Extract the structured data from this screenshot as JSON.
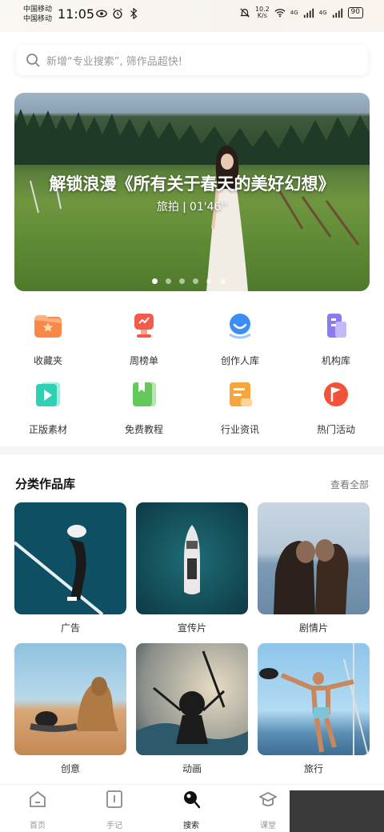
{
  "status_bar": {
    "carrier_1": "中国移动",
    "carrier_2": "中国移动",
    "time": "11:05",
    "net_speed_value": "10.2",
    "net_speed_unit": "K/s",
    "signal_1": "4G",
    "signal_2": "4G",
    "battery": "90"
  },
  "search": {
    "placeholder": "新增“专业搜索”, 筛作品超快!",
    "icon": "search-icon"
  },
  "banner": {
    "title": "解锁浪漫《所有关于春天的美好幻想》",
    "subtitle": "旅拍  ǀ 01'46''",
    "dot_count": 6,
    "active_dot": 1
  },
  "quick_links": [
    {
      "label": "收藏夹",
      "icon": "folder-star-icon",
      "color": "#f7884a"
    },
    {
      "label": "周榜单",
      "icon": "trophy-icon",
      "color": "#f25a4c"
    },
    {
      "label": "创作人库",
      "icon": "creator-icon",
      "color": "#3c8df5"
    },
    {
      "label": "机构库",
      "icon": "building-icon",
      "color": "#8b7bf0"
    },
    {
      "label": "正版素材",
      "icon": "play-file-icon",
      "color": "#2fd0b3"
    },
    {
      "label": "免费教程",
      "icon": "book-icon",
      "color": "#63c95a"
    },
    {
      "label": "行业资讯",
      "icon": "news-icon",
      "color": "#f8a53c"
    },
    {
      "label": "热门活动",
      "icon": "flag-icon",
      "color": "#f2513a"
    }
  ],
  "category_section": {
    "title": "分类作品库",
    "more": "查看全部",
    "cards": [
      {
        "label": "广告"
      },
      {
        "label": "宣传片"
      },
      {
        "label": "剧情片"
      },
      {
        "label": "创意"
      },
      {
        "label": "动画"
      },
      {
        "label": "旅行"
      }
    ]
  },
  "tab_bar": {
    "tabs": [
      {
        "label": "首页",
        "icon": "home-icon"
      },
      {
        "label": "手记",
        "icon": "notebook-icon"
      },
      {
        "label": "搜索",
        "icon": "search-icon"
      },
      {
        "label": "课堂",
        "icon": "graduation-cap-icon"
      }
    ],
    "active": "搜索"
  }
}
